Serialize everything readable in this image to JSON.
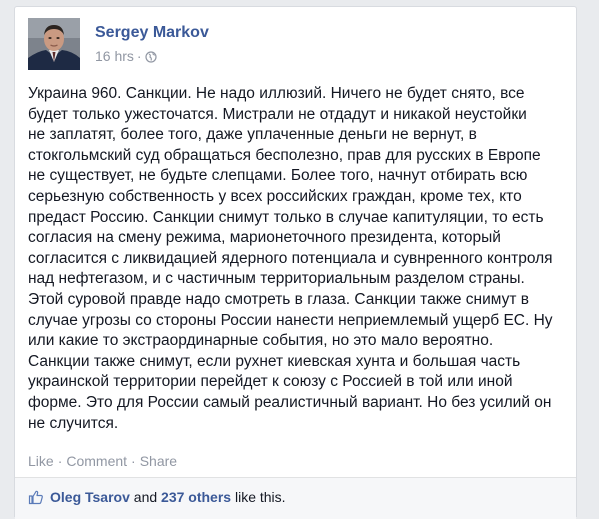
{
  "post": {
    "author": "Sergey Markov",
    "time": "16 hrs",
    "separator": "·",
    "privacy_icon": "globe-icon",
    "lines": [
      "Украина 960. Санкции. Не надо иллюзий. Ничего не будет снято, все",
      "будет только ужесточатся. Мистрали не отдадут и никакой неустойки",
      "не заплатят, более того, даже уплаченные деньги не вернут, в",
      "стокгольмский суд обращаться бесполезно, прав для русских в Европе",
      "не существует, не будьте слепцами. Более того, начнут отбирать всю",
      "серьезную собственность у всех российских граждан, кроме тех, кто",
      "предаст Россию. Санкции снимут только в случае капитуляции, то есть",
      "согласия на смену режима, марионеточного президента, который",
      "согласится с ликвидацией ядерного потенциала и сувнренного контроля",
      "над нефтегазом, и с частичным территориальным разделом страны.",
      "Этой суровой правде надо смотреть в глаза. Санкции также снимут в",
      "случае угрозы со стороны России нанести неприемлемый ущерб ЕС. Ну",
      "или какие то экстраординарные события, но это мало вероятно.",
      "Санкции также снимут, если рухнет киевская хунта и большая часть",
      "украинской территории перейдет к союзу с Россией в той или иной",
      "форме. Это для России самый реалистичный вариант. Но без усилий он",
      "не случится."
    ]
  },
  "actions": {
    "like": "Like",
    "comment": "Comment",
    "share": "Share",
    "separator": "·"
  },
  "likes": {
    "icon": "thumbs-up-icon",
    "first_liker": "Oleg Tsarov",
    "and_text": " and ",
    "others": "237 others",
    "suffix": " like this."
  },
  "colors": {
    "link": "#3b5998",
    "meta": "#9197a3",
    "text": "#141823",
    "likes_bg": "#f6f7f9"
  }
}
